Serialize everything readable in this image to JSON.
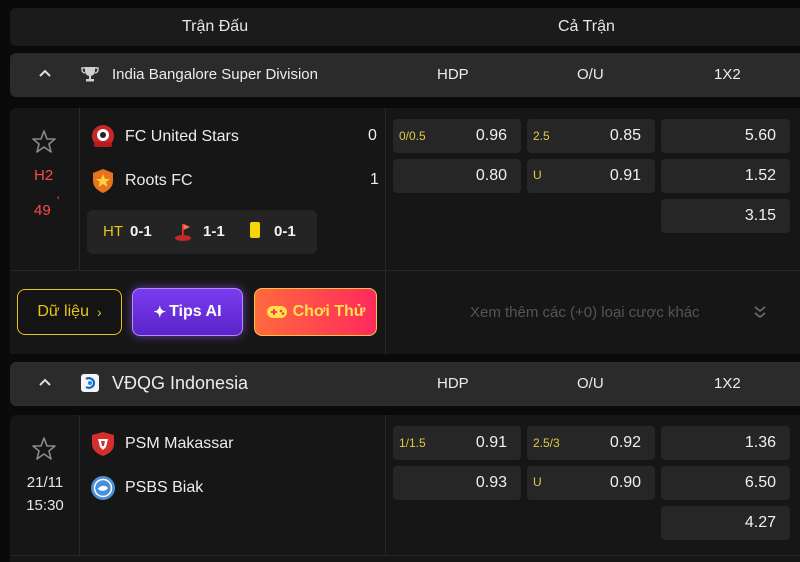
{
  "header": {
    "match_col": "Trận Đấu",
    "full_match_col": "Cả Trận"
  },
  "market_headers": {
    "hdp": "HDP",
    "ou": "O/U",
    "x12": "1X2"
  },
  "leagues": [
    {
      "name": "India Bangalore Super Division",
      "icon": "trophy-icon",
      "match": {
        "status": "H2",
        "minute": "49",
        "minute_mark": "'",
        "home": {
          "name": "FC United Stars",
          "score": "0"
        },
        "away": {
          "name": "Roots FC",
          "score": "1"
        },
        "ht_label": "HT",
        "ht_score": "0-1",
        "corners": "1-1",
        "cards": "0-1",
        "hdp": {
          "line": "0/0.5",
          "home": "0.96",
          "away": "0.80"
        },
        "ou": {
          "line": "2.5",
          "over": "0.85",
          "under_label": "U",
          "under": "0.91"
        },
        "x12": {
          "home": "5.60",
          "away": "1.52",
          "draw": "3.15"
        }
      }
    },
    {
      "name": "VĐQG Indonesia",
      "icon": "indonesia-league-icon",
      "match": {
        "date": "21/11",
        "time": "15:30",
        "home": {
          "name": "PSM Makassar"
        },
        "away": {
          "name": "PSBS Biak"
        },
        "hdp": {
          "line": "1/1.5",
          "home": "0.91",
          "away": "0.93"
        },
        "ou": {
          "line": "2.5/3",
          "over": "0.92",
          "under_label": "U",
          "under": "0.90"
        },
        "x12": {
          "home": "1.36",
          "away": "6.50",
          "draw": "4.27"
        }
      }
    }
  ],
  "actions": {
    "data_button": "Dữ liệu",
    "tips_button": "Tips AI",
    "play_button": "Chơi Thử",
    "more_bets": "Xem thêm các (+0) loại cược khác"
  },
  "colors": {
    "accent_yellow": "#e6c619",
    "tips_purple": "#8a4bff",
    "play_gradient_start": "#ff6a3d",
    "play_gradient_end": "#ff2a5c",
    "live_red": "#ff4a4a"
  }
}
